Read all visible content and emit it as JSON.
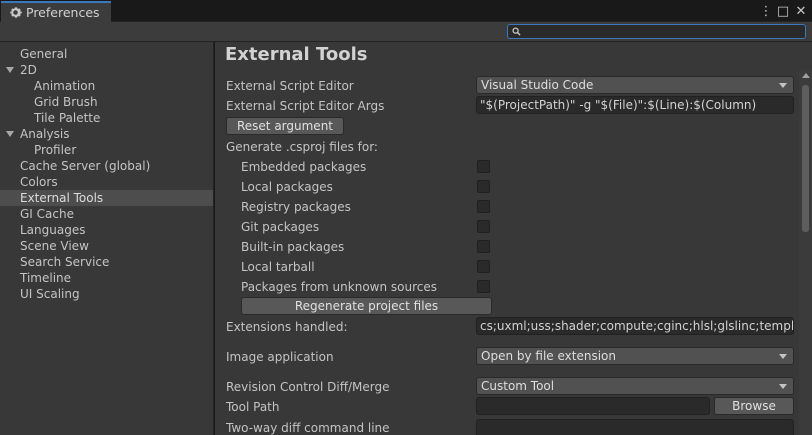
{
  "window": {
    "tab_title": "Preferences",
    "controls": {
      "more": "⋮",
      "maximize": "□",
      "close": "✕"
    }
  },
  "toolbar": {
    "search_value": ""
  },
  "sidebar": {
    "items": [
      {
        "label": "General",
        "level": 0
      },
      {
        "label": "2D",
        "level": 0,
        "expanded": true
      },
      {
        "label": "Animation",
        "level": 1
      },
      {
        "label": "Grid Brush",
        "level": 1
      },
      {
        "label": "Tile Palette",
        "level": 1
      },
      {
        "label": "Analysis",
        "level": 0,
        "expanded": true
      },
      {
        "label": "Profiler",
        "level": 1
      },
      {
        "label": "Cache Server (global)",
        "level": 0
      },
      {
        "label": "Colors",
        "level": 0
      },
      {
        "label": "External Tools",
        "level": 0,
        "selected": true
      },
      {
        "label": "GI Cache",
        "level": 0
      },
      {
        "label": "Languages",
        "level": 0
      },
      {
        "label": "Scene View",
        "level": 0
      },
      {
        "label": "Search Service",
        "level": 0
      },
      {
        "label": "Timeline",
        "level": 0
      },
      {
        "label": "UI Scaling",
        "level": 0
      }
    ]
  },
  "main": {
    "title": "External Tools",
    "script_editor": {
      "label": "External Script Editor",
      "value": "Visual Studio Code"
    },
    "script_editor_args": {
      "label": "External Script Editor Args",
      "value": "\"$(ProjectPath)\" -g \"$(File)\":$(Line):$(Column)"
    },
    "reset_button": "Reset argument",
    "csproj_header": "Generate .csproj files for:",
    "csproj_options": [
      {
        "label": "Embedded packages",
        "checked": false
      },
      {
        "label": "Local packages",
        "checked": false
      },
      {
        "label": "Registry packages",
        "checked": false
      },
      {
        "label": "Git packages",
        "checked": false
      },
      {
        "label": "Built-in packages",
        "checked": false
      },
      {
        "label": "Local tarball",
        "checked": false
      },
      {
        "label": "Packages from unknown sources",
        "checked": false
      }
    ],
    "regenerate_button": "Regenerate project files",
    "extensions": {
      "label": "Extensions handled:",
      "value": "cs;uxml;uss;shader;compute;cginc;hlsl;glslinc;template;r"
    },
    "image_app": {
      "label": "Image application",
      "value": "Open by file extension"
    },
    "revision": {
      "label": "Revision Control Diff/Merge",
      "value": "Custom Tool"
    },
    "tool_path": {
      "label": "Tool Path",
      "value": "",
      "browse": "Browse"
    },
    "two_way": {
      "label": "Two-way diff command line",
      "value": ""
    }
  },
  "colors": {
    "accent": "#3a79bb",
    "panel": "#383838",
    "selected": "#4d4d4d"
  }
}
